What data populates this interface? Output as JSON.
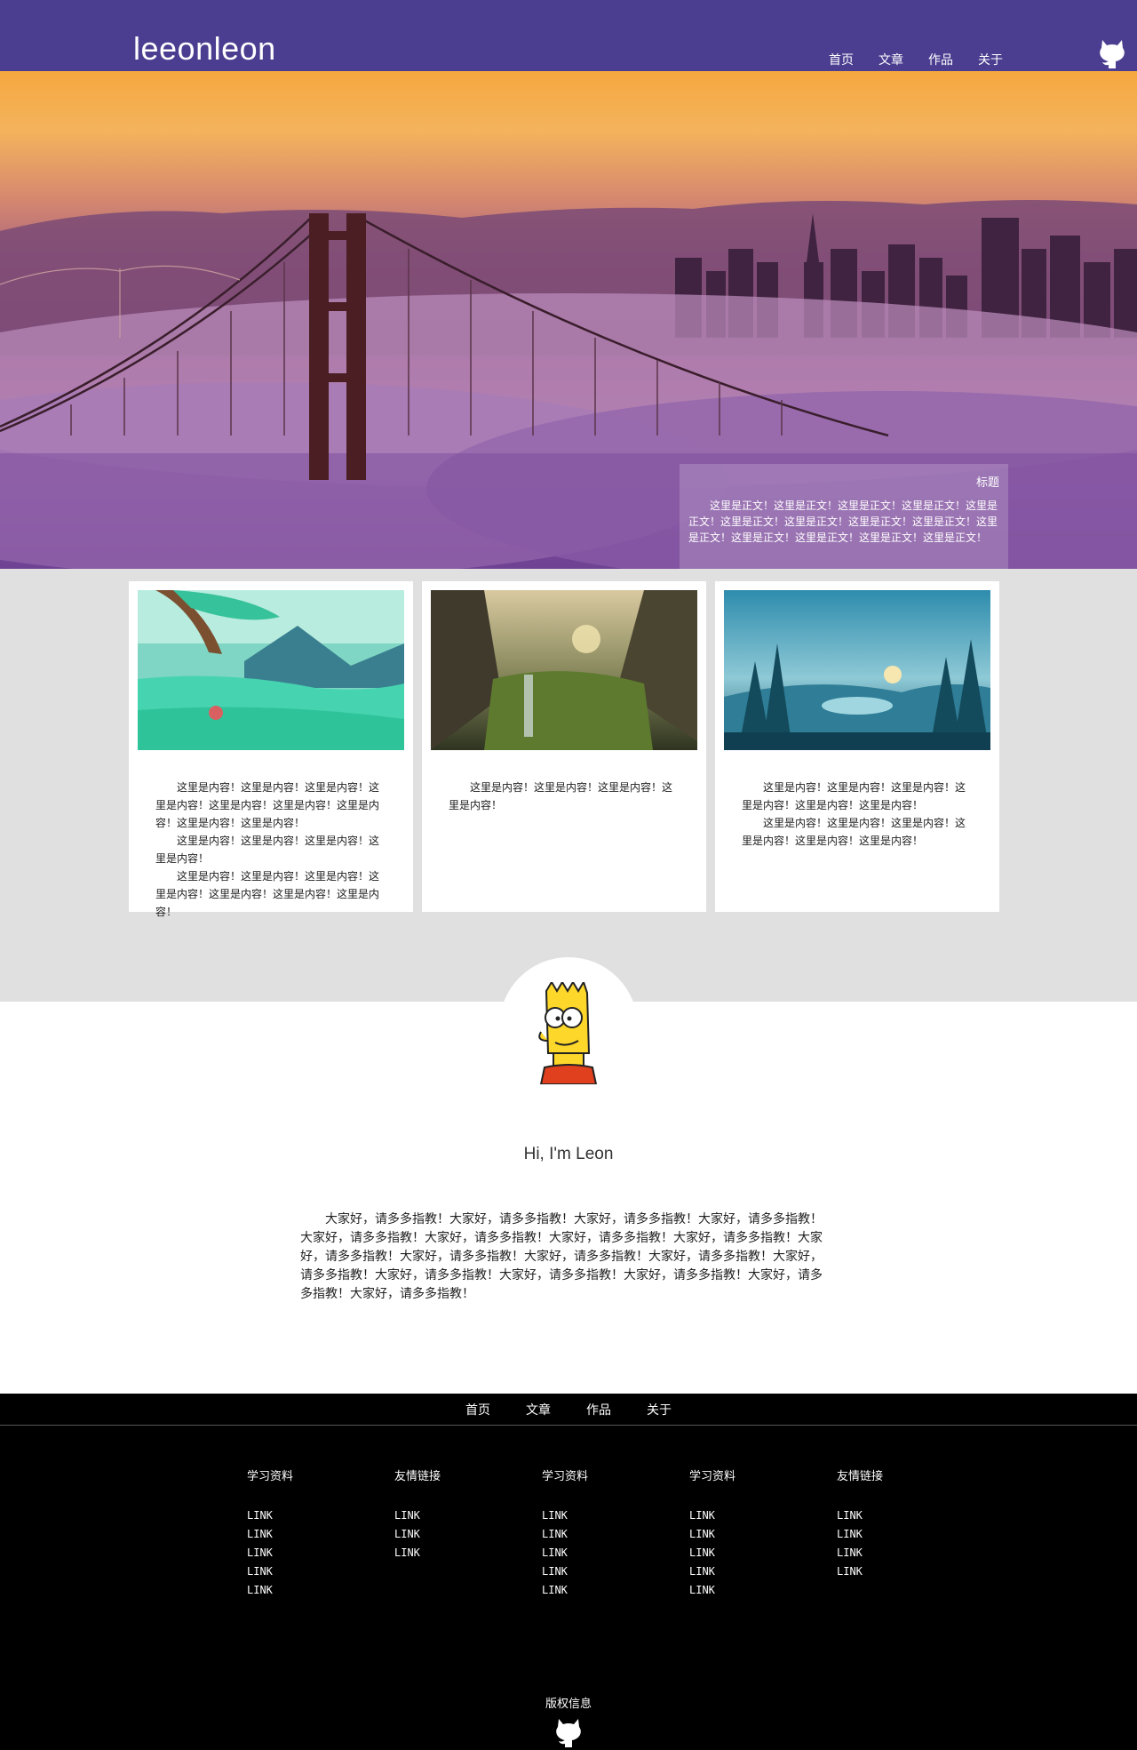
{
  "header": {
    "logo": "leeonleon",
    "nav": [
      "首页",
      "文章",
      "作品",
      "关于"
    ],
    "github_icon": "github-octocat-icon"
  },
  "hero": {
    "image": "golden-gate-bridge-fog-sunset",
    "caption_title": "标题",
    "caption_body": "这里是正文！这里是正文！这里是正文！这里是正文！这里是正文！这里是正文！这里是正文！这里是正文！这里是正文！这里是正文！这里是正文！这里是正文！这里是正文！这里是正文！"
  },
  "cards": [
    {
      "image": "anime-landscape-tree-meadow",
      "paragraphs": [
        "这里是内容！这里是内容！这里是内容！这里是内容！这里是内容！这里是内容！这里是内容！这里是内容！这里是内容！",
        "这里是内容！这里是内容！这里是内容！这里是内容！",
        "这里是内容！这里是内容！这里是内容！这里是内容！这里是内容！这里是内容！这里是内容！"
      ]
    },
    {
      "image": "fantasy-cliff-waterfall",
      "paragraphs": [
        "这里是内容！这里是内容！这里是内容！这里是内容！"
      ]
    },
    {
      "image": "firewatch-forest-lake-deer",
      "paragraphs": [
        "这里是内容！这里是内容！这里是内容！这里是内容！这里是内容！这里是内容！",
        "这里是内容！这里是内容！这里是内容！这里是内容！这里是内容！这里是内容！"
      ]
    }
  ],
  "profile": {
    "avatar": "bart-simpson-avatar",
    "greeting": "Hi, I'm Leon",
    "intro": "大家好，请多多指教！大家好，请多多指教！大家好，请多多指教！大家好，请多多指教！大家好，请多多指教！大家好，请多多指教！大家好，请多多指教！大家好，请多多指教！大家好，请多多指教！大家好，请多多指教！大家好，请多多指教！大家好，请多多指教！大家好，请多多指教！大家好，请多多指教！大家好，请多多指教！大家好，请多多指教！大家好，请多多指教！大家好，请多多指教！"
  },
  "footer": {
    "nav": [
      "首页",
      "文章",
      "作品",
      "关于"
    ],
    "columns": [
      {
        "title": "学习资料",
        "links": [
          "LINK",
          "LINK",
          "LINK",
          "LINK",
          "LINK"
        ]
      },
      {
        "title": "友情链接",
        "links": [
          "LINK",
          "LINK",
          "LINK"
        ]
      },
      {
        "title": "学习资料",
        "links": [
          "LINK",
          "LINK",
          "LINK",
          "LINK",
          "LINK"
        ]
      },
      {
        "title": "学习资料",
        "links": [
          "LINK",
          "LINK",
          "LINK",
          "LINK",
          "LINK"
        ]
      },
      {
        "title": "友情链接",
        "links": [
          "LINK",
          "LINK",
          "LINK",
          "LINK"
        ]
      }
    ],
    "copyright": "版权信息",
    "github_icon": "github-octocat-icon"
  },
  "colors": {
    "header_bg": "#4b3e90",
    "band_bg": "#e0e0e0",
    "footer_bg": "#000000"
  }
}
